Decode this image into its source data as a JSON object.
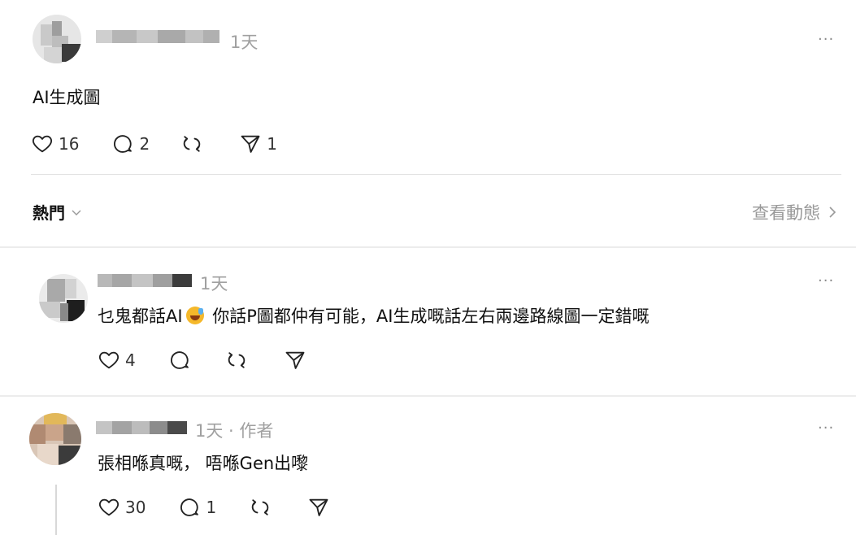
{
  "post": {
    "time": "1天",
    "body": "AI生成圖",
    "likes": "16",
    "replies": "2",
    "reposts": "",
    "shares": "1",
    "more_label": "···"
  },
  "sort_bar": {
    "sort_label": "熱門",
    "activity_label": "查看動態"
  },
  "replies": [
    {
      "time": "1天",
      "text_before_emoji": "乜鬼都話AI",
      "emoji": "grinning-sweat-emoji",
      "text_after_emoji": "你話P圖都仲有可能，AI生成嘅話左右兩邊路線圖一定錯嘅",
      "likes": "4",
      "replies": "",
      "more_label": "···"
    },
    {
      "time": "1天 · 作者",
      "text": "張相喺真嘅， 唔喺Gen出嚟",
      "likes": "30",
      "replies": "1",
      "more_label": "···"
    }
  ],
  "icons": {
    "like": "heart-icon",
    "reply": "comment-icon",
    "repost": "repost-icon",
    "share": "send-icon"
  }
}
